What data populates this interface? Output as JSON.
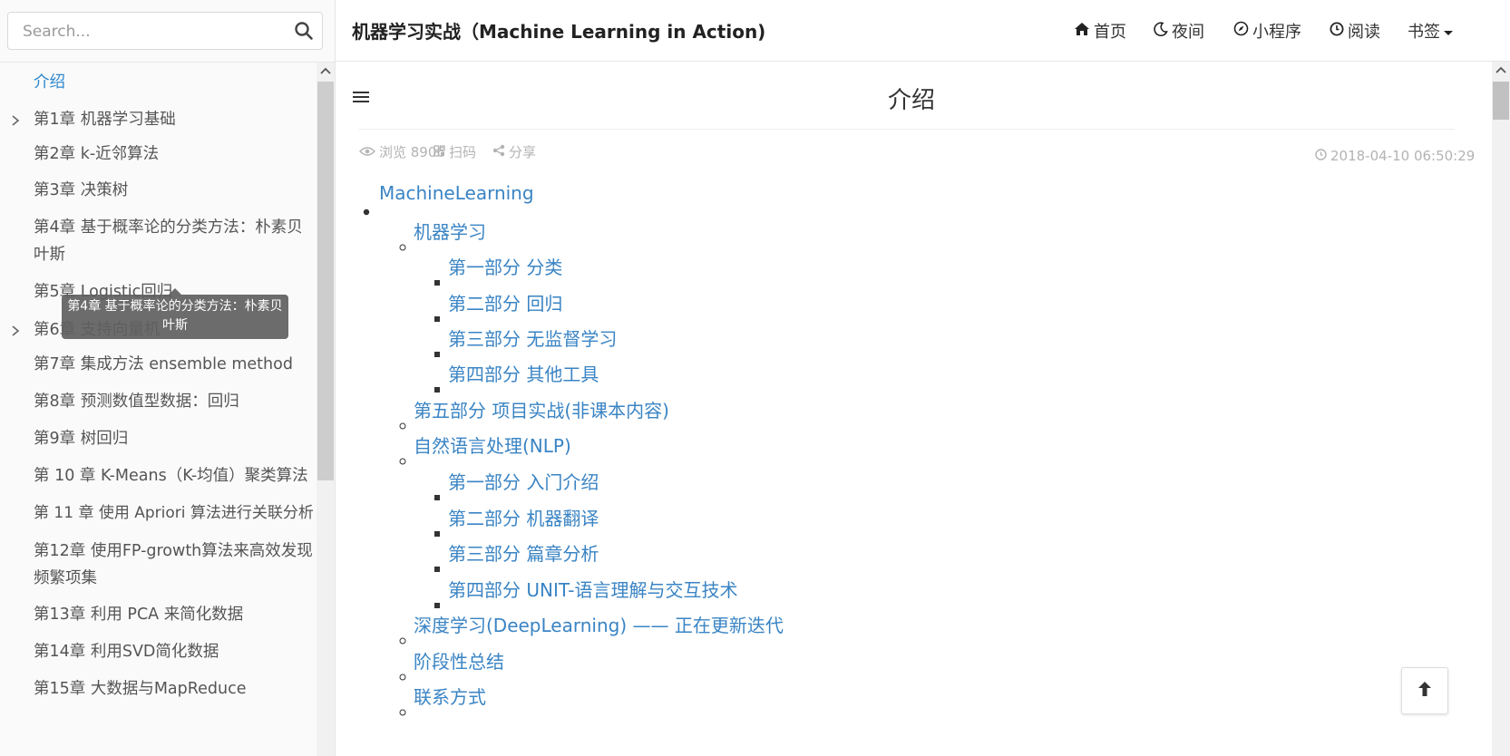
{
  "search": {
    "placeholder": "Search..."
  },
  "sidebar": {
    "items": [
      {
        "label": "介绍",
        "active": true
      },
      {
        "label": "第1章 机器学习基础",
        "expandable": true
      },
      {
        "label": "第2章 k-近邻算法"
      },
      {
        "label": "第3章 决策树"
      },
      {
        "label": "第4章 基于概率论的分类方法：朴素贝叶斯"
      },
      {
        "label": "第5章 Logistic回归"
      },
      {
        "label": "第6章 支持向量机",
        "expandable": true
      },
      {
        "label": "第7章 集成方法 ensemble method"
      },
      {
        "label": "第8章 预测数值型数据：回归"
      },
      {
        "label": "第9章 树回归"
      },
      {
        "label": "第 10 章 K-Means（K-均值）聚类算法"
      },
      {
        "label": "第 11 章 使用 Apriori 算法进行关联分析"
      },
      {
        "label": "第12章 使用FP-growth算法来高效发现频繁项集"
      },
      {
        "label": "第13章 利用 PCA 来简化数据"
      },
      {
        "label": "第14章 利用SVD简化数据"
      },
      {
        "label": "第15章 大数据与MapReduce"
      }
    ],
    "tooltip": "第4章 基于概率论的分类方法：朴素贝叶斯"
  },
  "header": {
    "title": "机器学习实战（Machine Learning in Action)",
    "nav": {
      "home": "首页",
      "night": "夜间",
      "miniapp": "小程序",
      "read": "阅读",
      "bookmark": "书签"
    }
  },
  "main": {
    "page_title": "介绍",
    "meta": {
      "views": "浏览 8906",
      "qrcode": "扫码",
      "share": "分享",
      "date": "2018-04-10 06:50:29"
    },
    "toc": [
      "MachineLearning",
      "机器学习",
      "第一部分 分类",
      "第二部分 回归",
      "第三部分 无监督学习",
      "第四部分 其他工具",
      "第五部分 项目实战(非课本内容)",
      "自然语言处理(NLP)",
      "第一部分 入门介绍",
      "第二部分 机器翻译",
      "第三部分 篇章分析",
      "第四部分 UNIT-语言理解与交互技术",
      "深度学习(DeepLearning) —— 正在更新迭代",
      "阶段性总结",
      "联系方式"
    ]
  },
  "colors": {
    "link": "#3a84c4",
    "active": "#2e87cc"
  },
  "icons": [
    "search-icon",
    "home-icon",
    "moon-icon",
    "compass-icon",
    "clock-icon",
    "caret-down-icon",
    "menu-icon",
    "eye-icon",
    "qrcode-icon",
    "share-icon",
    "chevron-right-icon",
    "arrow-up-icon"
  ]
}
